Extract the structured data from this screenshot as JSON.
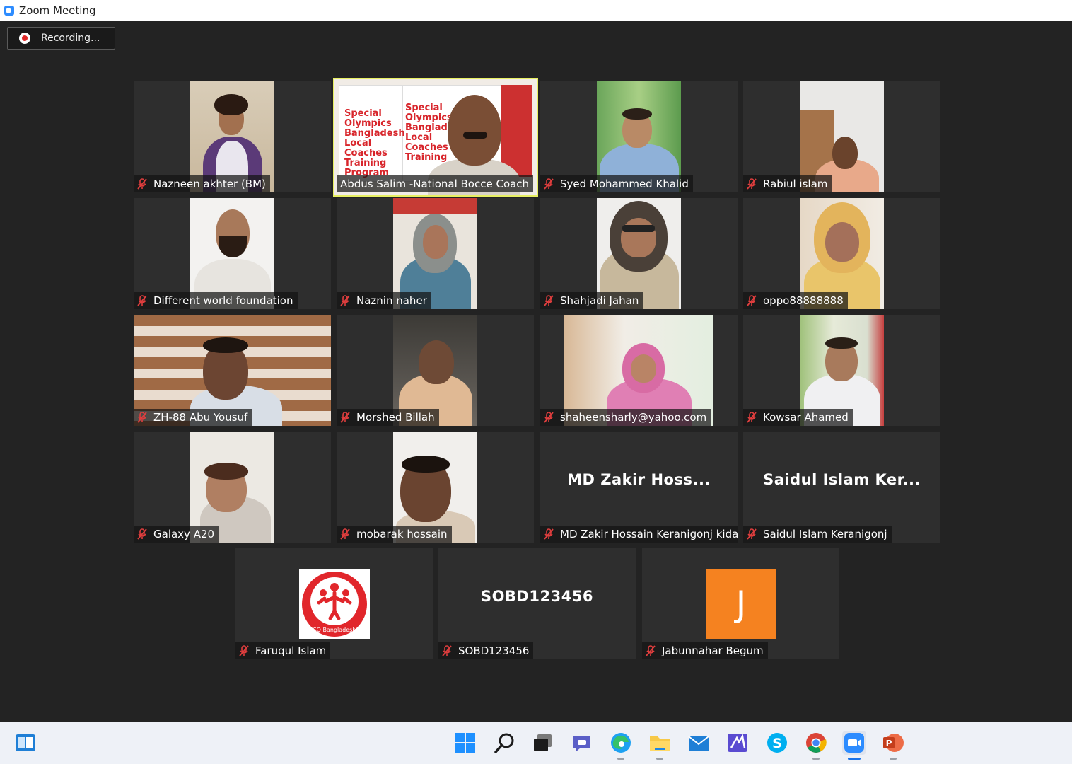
{
  "window": {
    "title": "Zoom Meeting"
  },
  "recording": {
    "label": "Recording..."
  },
  "participants": [
    {
      "name": "Nazneen akhter (BM)"
    },
    {
      "name": "Abdus Salim -National Bocce Coach",
      "banner_text": "Special Olympics Bangladesh Local Coaches Training Program"
    },
    {
      "name": "Syed Mohammed Khalid"
    },
    {
      "name": "Rabiul islam"
    },
    {
      "name": "Different world foundation"
    },
    {
      "name": "Naznin naher"
    },
    {
      "name": "Shahjadi Jahan"
    },
    {
      "name": "oppo88888888"
    },
    {
      "name": "ZH-88 Abu Yousuf"
    },
    {
      "name": "Morshed Billah"
    },
    {
      "name": "shaheensharly@yahoo.com"
    },
    {
      "name": "Kowsar Ahamed"
    },
    {
      "name": "Galaxy A20"
    },
    {
      "name": "mobarak hossain"
    },
    {
      "name": "MD  Zakir Hossain Keranigonj kidas",
      "display": "MD  Zakir Hoss..."
    },
    {
      "name": "Saidul Islam Keranigonj",
      "display": "Saidul Islam Ker..."
    },
    {
      "name": "Faruqul Islam",
      "logo_text": "SO Bangladesh"
    },
    {
      "name": "SOBD123456",
      "display": "SOBD123456"
    },
    {
      "name": "Jabunnahar Begum",
      "avatar_letter": "J"
    }
  ],
  "taskbar": {
    "apps": [
      "widgets",
      "start",
      "search",
      "task-view",
      "chat",
      "edge",
      "file-explorer",
      "mail",
      "zoom-whiteboard",
      "skype",
      "chrome",
      "zoom",
      "powerpoint"
    ]
  },
  "colors": {
    "accent_active_speaker": "#e7ef62",
    "muted_icon": "#e03e3e",
    "avatar_orange": "#f58220"
  }
}
